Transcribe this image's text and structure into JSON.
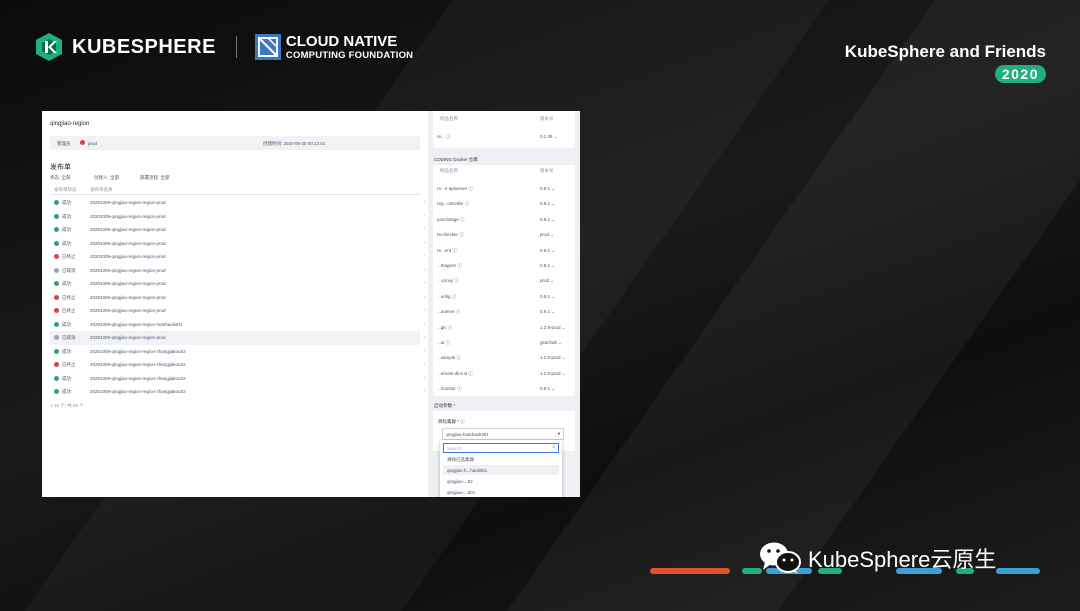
{
  "slide": {
    "brand_name": "KUBESPHERE",
    "partner_line1": "CLOUD NATIVE",
    "partner_line2": "COMPUTING FOUNDATION",
    "event_title": "KubeSphere and Friends",
    "event_year": "2020",
    "footer_account": "KubeSphere云原生",
    "icons": [
      "kubesphere-logo-icon",
      "cncf-logo-icon",
      "wechat-icon"
    ],
    "colors": {
      "accent_green": "#1fb07c",
      "bar_orange": "#e0512d",
      "bar_blue": "#3aa0d8",
      "bar_green": "#1fb07c"
    }
  },
  "app": {
    "region_title": "qingjiao-region",
    "info": {
      "label_a": "管理员",
      "label_b": "prod",
      "time_text": "创建时间: 2020-05-20 00:13:01"
    },
    "section_title": "发布单",
    "filters": [
      "状态: 全部",
      "创建人: 全部",
      "部署流程: 全部"
    ],
    "columns": [
      "发布单状态",
      "发布单名称"
    ],
    "rows": [
      {
        "status": "成功",
        "type": "ok",
        "name": "20201009-qingjiao-region-region-prod"
      },
      {
        "status": "成功",
        "type": "ok",
        "name": "20201009-qingjiao-region-region-prod"
      },
      {
        "status": "成功",
        "type": "ok",
        "name": "20201009-qingjiao-region-region-prod"
      },
      {
        "status": "成功",
        "type": "ok",
        "name": "20201009-qingjiao-region-region-prod"
      },
      {
        "status": "已终止",
        "type": "fail",
        "name": "20201009-qingjiao-region-region-prod"
      },
      {
        "status": "已取消",
        "type": "cancel",
        "name": "20201009-qingjiao-region-region-prod"
      },
      {
        "status": "成功",
        "type": "ok",
        "name": "20201009-qingjiao-region-region-prod"
      },
      {
        "status": "已终止",
        "type": "fail",
        "name": "20201009-qingjiao-region-region-prod"
      },
      {
        "status": "已终止",
        "type": "fail",
        "name": "20201009-qingjiao-region-region-prod"
      },
      {
        "status": "成功",
        "type": "ok",
        "name": "20201009-qingjiao-region-region-hutehaokit01"
      },
      {
        "status": "已取消",
        "type": "cancel",
        "name": "20201009-qingjiao-region-region-prod"
      },
      {
        "status": "成功",
        "type": "ok",
        "name": "20201009-qingjiao-region-region-zhangjiakou02"
      },
      {
        "status": "已终止",
        "type": "fail",
        "name": "20201009-qingjiao-region-region-zhangjiakou02"
      },
      {
        "status": "成功",
        "type": "ok",
        "name": "20201009-qingjiao-region-region-zhangjiakou02"
      },
      {
        "status": "成功",
        "type": "ok",
        "name": "20201009-qingjiao-region-region-zhangjiakou02"
      }
    ],
    "pager_text": "1-15 个, 共 68 个"
  },
  "panel": {
    "col_image": "制品名称",
    "col_version": "版本号",
    "top_item": {
      "name": "re... ⓘ",
      "version": "0.1.39 ⌄"
    },
    "registry_title": "CODING Docker 仓库",
    "items": [
      {
        "name": "re...n-apiserver ⓘ",
        "version": "0.9.1 ⌄"
      },
      {
        "name": "reg...ontroller ⓘ",
        "version": "0.9.1 ⌄"
      },
      {
        "name": "yanchitage ⓘ",
        "version": "0.9.1 ⌄"
      },
      {
        "name": "ta-checker ⓘ",
        "version": "prod ⌄"
      },
      {
        "name": "re...ent ⓘ",
        "version": "0.9.1 ⌄"
      },
      {
        "name": "...thagent ⓘ",
        "version": "0.9.1 ⌄"
      },
      {
        "name": "...-proxy ⓘ",
        "version": "prod ⌄"
      },
      {
        "name": "...onfig ⓘ",
        "version": "0.9.1 ⌄"
      },
      {
        "name": "...oueme ⓘ",
        "version": "0.9.1 ⌄"
      },
      {
        "name": "...gic ⓘ",
        "version": "1.2.8-prod ⌄"
      },
      {
        "name": "...ut ⓘ",
        "version": "glotchalt ⌄"
      },
      {
        "name": "...sample ⓘ",
        "version": "1.2.8-prod ⌄"
      },
      {
        "name": "...emote-db-init ⓘ",
        "version": "1.2.8-prod ⌄"
      },
      {
        "name": "...monitor ⓘ",
        "version": "0.9.1 ⌄"
      }
    ],
    "startup_label": "启动参数 *",
    "target_label": "目标集群 * ⓘ",
    "selected_cluster": "qingjiao-hutehaokit01",
    "search_placeholder": "Search",
    "dropdown_items": [
      "清除已选集群",
      "qingjiao-h...haokit01",
      "qingjiao-...02",
      "qingjiao-...d01"
    ]
  }
}
